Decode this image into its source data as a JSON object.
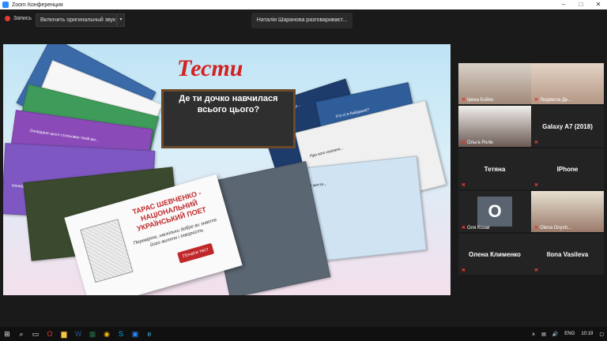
{
  "window": {
    "title": "Zoom Конференция"
  },
  "toolbar": {
    "record_label": "Запись",
    "original_sound_label": "Включить оригинальный звук",
    "speaking_status": "Наталія Шаранова разговариваєт..."
  },
  "slide": {
    "title": "Тести",
    "blackboard_text": "Де ти дочко навчилася всього цього?",
    "card_shevchenko_title": "ТАРАС ШЕВЧЕНКО - НАЦІОНАЛЬНИЙ УКРАЇНСЬКИЙ ПОЕТ",
    "card_shevchenko_sub": "Перевірте, наскільки добре ви знаєте його життя і творчість",
    "card_shevchenko_button": "Почати тест",
    "card_labels": [
      "Оповідання Фантазія",
      "Оповіданя цього стильових течій ми...",
      "Зборы литератур...",
      "Хто сі в Кайдашеі?",
      "Про кого сказано...",
      "Моя зборі життя..."
    ]
  },
  "participants": [
    {
      "name": "Ірина Бойко",
      "type": "video"
    },
    {
      "name": "Людмила Де...",
      "type": "video"
    },
    {
      "name": "Ольга Ролік",
      "type": "video"
    },
    {
      "name": "Galaxy A7 (2018)",
      "type": "text"
    },
    {
      "name": "Тетяна",
      "type": "text"
    },
    {
      "name": "IPhone",
      "type": "text"
    },
    {
      "name": "Оля Козак",
      "type": "avatar",
      "avatar_letter": "О"
    },
    {
      "name": "Olena Onysh...",
      "type": "video"
    },
    {
      "name": "Олена Клименко",
      "type": "text"
    },
    {
      "name": "Ilona Vasileva",
      "type": "text"
    }
  ],
  "taskbar": {
    "language": "ENG",
    "time": "10:19"
  },
  "colors": {
    "accent": "#2d8cff",
    "record": "#e53935",
    "slide_title": "#d42020"
  }
}
